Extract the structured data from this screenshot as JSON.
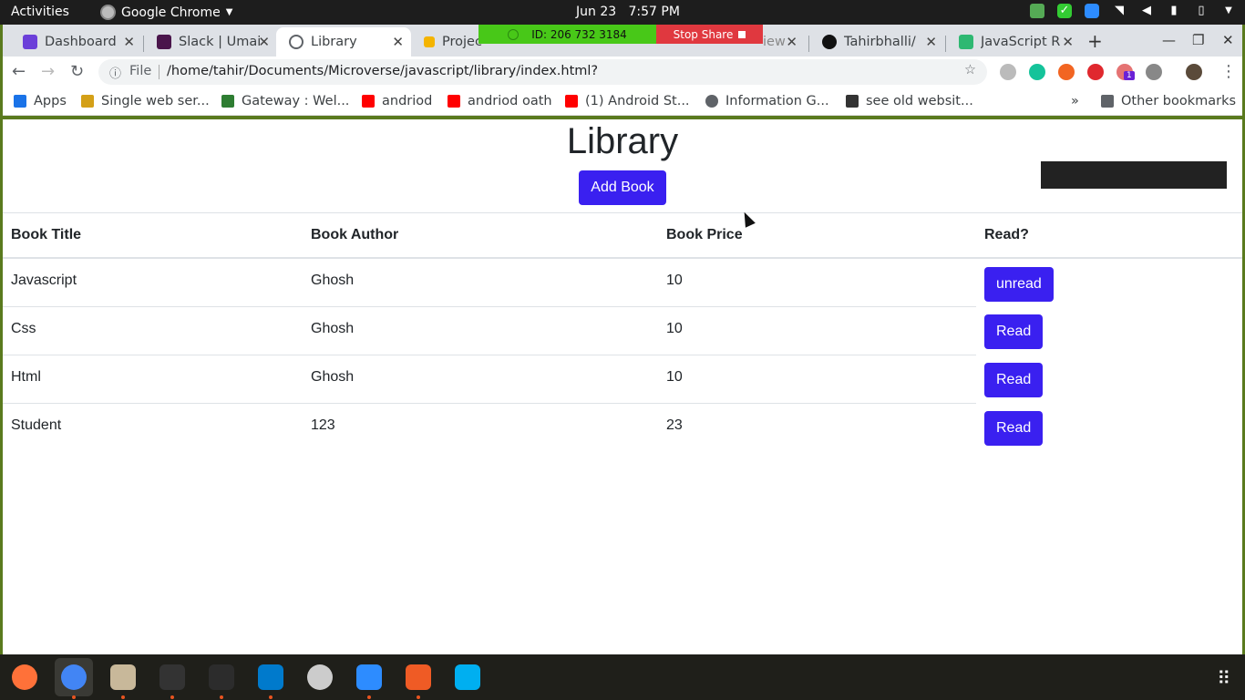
{
  "topbar": {
    "activities": "Activities",
    "app": "Google Chrome",
    "clock_date": "Jun 23",
    "clock_time": "7:57 PM"
  },
  "zoom": {
    "id": "ID: 206 732 3184",
    "stop": "Stop Share"
  },
  "tabs": [
    {
      "title": "Dashboard",
      "color": "#6b3fd9"
    },
    {
      "title": "Slack | Umai",
      "color": "#4a154b"
    },
    {
      "title": "Library",
      "color": "#5f6368"
    },
    {
      "title": "Projec",
      "color": "#f4b400"
    },
    {
      "title": "iew",
      "color": "#f4b400"
    },
    {
      "title": "Tahirbhalli/",
      "color": "#111111"
    },
    {
      "title": "JavaScript R",
      "color": "#2eb872"
    }
  ],
  "address": {
    "scheme": "File",
    "url": "/home/tahir/Documents/Microverse/javascript/library/index.html?"
  },
  "bookmarks": [
    {
      "label": "Apps",
      "color": "#1a73e8"
    },
    {
      "label": "Single web ser...",
      "color": "#d4a017"
    },
    {
      "label": "Gateway : Wel...",
      "color": "#2e7d32"
    },
    {
      "label": "andriod",
      "color": "#ff0000"
    },
    {
      "label": "andriod oath",
      "color": "#ff0000"
    },
    {
      "label": "(1) Android St...",
      "color": "#ff0000"
    },
    {
      "label": "Information G...",
      "color": "#5f6368"
    },
    {
      "label": "see old websit...",
      "color": "#333333"
    }
  ],
  "bookmarks_more": "»",
  "other_bookmarks": "Other bookmarks",
  "page": {
    "title": "Library",
    "add_book": "Add Book",
    "headers": [
      "Book Title",
      "Book Author",
      "Book Price",
      "Read?"
    ],
    "rows": [
      {
        "title": "Javascript",
        "author": "Ghosh",
        "price": "10",
        "status": "unread"
      },
      {
        "title": "Css",
        "author": "Ghosh",
        "price": "10",
        "status": "Read"
      },
      {
        "title": "Html",
        "author": "Ghosh",
        "price": "10",
        "status": "Read"
      },
      {
        "title": "Student",
        "author": "123",
        "price": "23",
        "status": "Read"
      }
    ]
  },
  "extension_badge": "1",
  "colors": {
    "accent": "#3a20f0",
    "zoom_green": "#48c818",
    "zoom_red": "#e0383f"
  }
}
